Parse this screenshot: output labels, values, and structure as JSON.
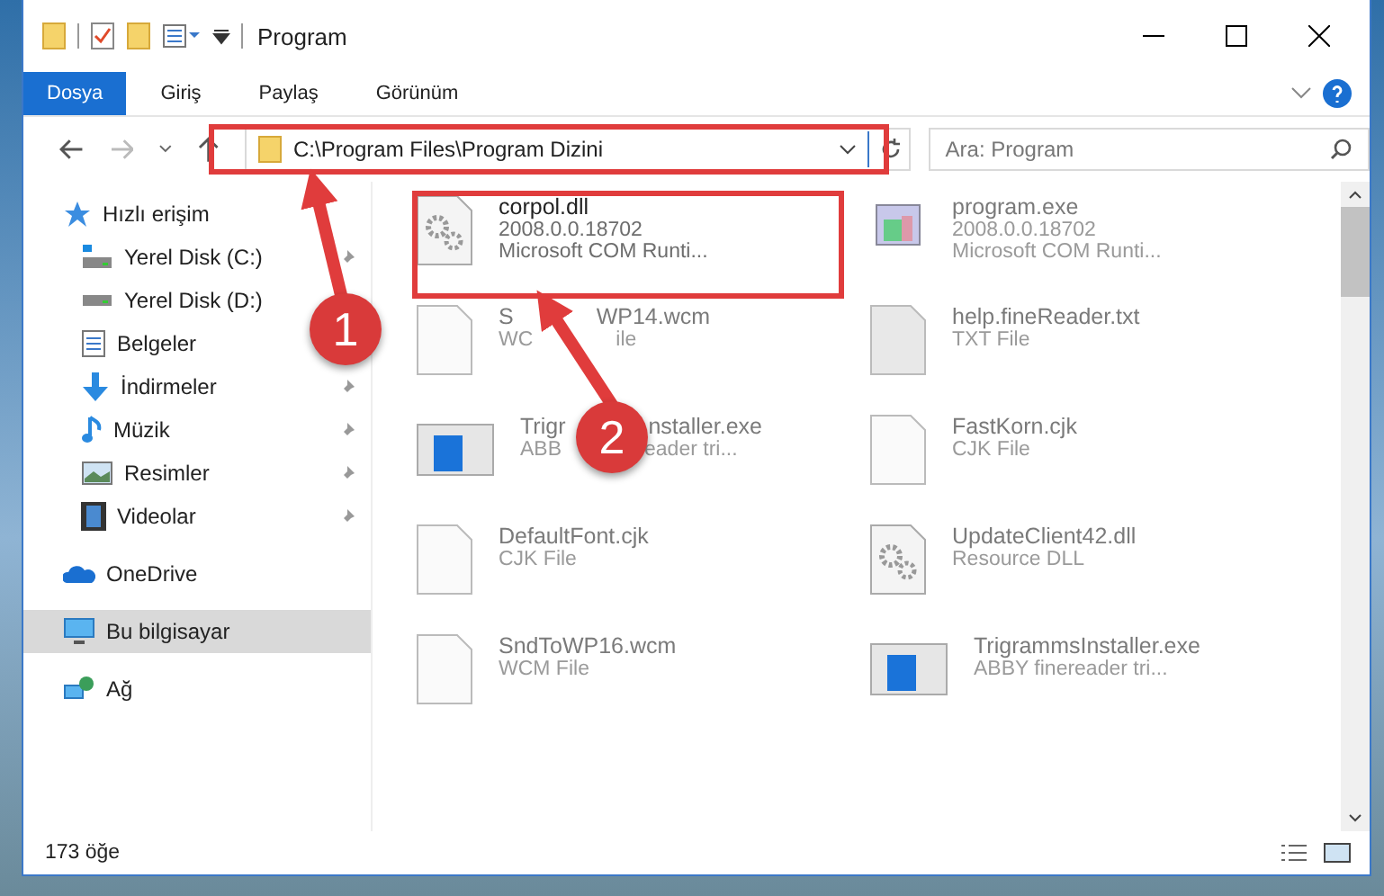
{
  "window": {
    "title": "Program"
  },
  "ribbon_tabs": [
    {
      "label": "Dosya",
      "selected": true
    },
    {
      "label": "Giriş",
      "selected": false
    },
    {
      "label": "Paylaş",
      "selected": false
    },
    {
      "label": "Görünüm",
      "selected": false
    }
  ],
  "address_bar": {
    "value": "C:\\Program Files\\Program Dizini"
  },
  "search": {
    "placeholder": "Ara: Program"
  },
  "sidebar": {
    "items": [
      {
        "label": "Hızlı erişim",
        "kind": "star",
        "selected": false,
        "children": [
          {
            "label": "Yerel Disk (C:)",
            "kind": "drive-win",
            "pinned": true,
            "selected": false
          },
          {
            "label": "Yerel Disk (D:)",
            "kind": "drive",
            "pinned": false,
            "selected": false
          },
          {
            "label": "Belgeler",
            "kind": "doc",
            "pinned": false,
            "selected": false
          },
          {
            "label": "İndirmeler",
            "kind": "download",
            "pinned": true,
            "selected": false
          },
          {
            "label": "Müzik",
            "kind": "music",
            "pinned": true,
            "selected": false
          },
          {
            "label": "Resimler",
            "kind": "picture",
            "pinned": true,
            "selected": false
          },
          {
            "label": "Videolar",
            "kind": "video",
            "pinned": true,
            "selected": false
          }
        ]
      },
      {
        "label": "OneDrive",
        "kind": "cloud",
        "selected": false
      },
      {
        "label": "Bu bilgisayar",
        "kind": "pc",
        "selected": true
      },
      {
        "label": "Ağ",
        "kind": "network",
        "selected": false
      }
    ]
  },
  "files": [
    {
      "name": [
        "corpol.dll"
      ],
      "details": [
        [
          "2008.0.0.18702"
        ],
        [
          "Microsoft COM Runti..."
        ]
      ],
      "kind": "dll",
      "faded": false
    },
    {
      "name": [
        "program.exe"
      ],
      "details": [
        [
          "2008.0.0.18702"
        ],
        [
          "Microsoft COM Runti..."
        ]
      ],
      "kind": "exe",
      "faded": true
    },
    {
      "name": [
        "S",
        "WP14.wcm"
      ],
      "details": [
        [
          "WC",
          "ile"
        ]
      ],
      "kind": "blank",
      "faded": true
    },
    {
      "name": [
        "help.fineReader.txt"
      ],
      "details": [
        [
          "TXT File"
        ]
      ],
      "kind": "grey",
      "faded": true
    },
    {
      "name": [
        "Trigr",
        "nstaller.exe"
      ],
      "details": [
        [
          "ABB",
          "eader tri..."
        ]
      ],
      "kind": "installer",
      "faded": true
    },
    {
      "name": [
        "FastKorn.cjk"
      ],
      "details": [
        [
          "CJK File"
        ]
      ],
      "kind": "blank",
      "faded": true
    },
    {
      "name": [
        "DefaultFont.cjk"
      ],
      "details": [
        [
          "CJK File"
        ]
      ],
      "kind": "blank",
      "faded": true
    },
    {
      "name": [
        "UpdateClient42.dll"
      ],
      "details": [
        [
          "Resource DLL"
        ]
      ],
      "kind": "dll",
      "faded": true
    },
    {
      "name": [
        "SndToWP16.wcm"
      ],
      "details": [
        [
          "WCM File"
        ]
      ],
      "kind": "blank",
      "faded": true
    },
    {
      "name": [
        "TrigrammsInstaller.exe"
      ],
      "details": [
        [
          "ABBY finereader tri..."
        ]
      ],
      "kind": "installer",
      "faded": true
    }
  ],
  "status_bar": {
    "count": "173 öğe"
  },
  "annotations": [
    {
      "number": "1"
    },
    {
      "number": "2"
    }
  ]
}
